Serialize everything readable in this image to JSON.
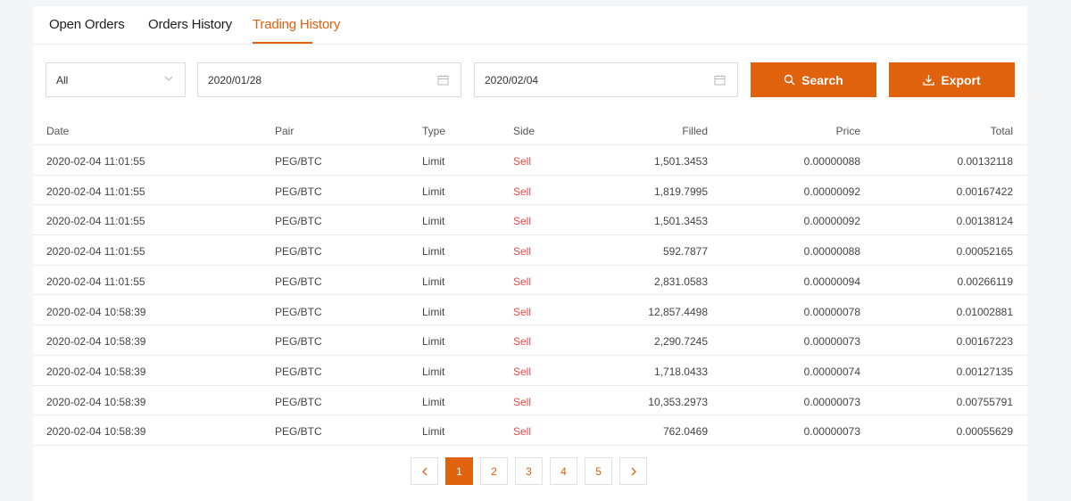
{
  "tabs": [
    {
      "label": "Open Orders"
    },
    {
      "label": "Orders History"
    },
    {
      "label": "Trading History"
    }
  ],
  "active_tab": 2,
  "filters": {
    "side_select": "All",
    "start_date": "2020/01/28",
    "end_date": "2020/02/04",
    "search_label": "Search",
    "export_label": "Export"
  },
  "table": {
    "headers": {
      "date": "Date",
      "pair": "Pair",
      "type": "Type",
      "side": "Side",
      "filled": "Filled",
      "price": "Price",
      "total": "Total"
    },
    "rows": [
      {
        "date": "2020-02-04 11:01:55",
        "pair": "PEG/BTC",
        "type": "Limit",
        "side": "Sell",
        "filled": "1,501.3453",
        "price": "0.00000088",
        "total": "0.00132118"
      },
      {
        "date": "2020-02-04 11:01:55",
        "pair": "PEG/BTC",
        "type": "Limit",
        "side": "Sell",
        "filled": "1,819.7995",
        "price": "0.00000092",
        "total": "0.00167422"
      },
      {
        "date": "2020-02-04 11:01:55",
        "pair": "PEG/BTC",
        "type": "Limit",
        "side": "Sell",
        "filled": "1,501.3453",
        "price": "0.00000092",
        "total": "0.00138124"
      },
      {
        "date": "2020-02-04 11:01:55",
        "pair": "PEG/BTC",
        "type": "Limit",
        "side": "Sell",
        "filled": "592.7877",
        "price": "0.00000088",
        "total": "0.00052165"
      },
      {
        "date": "2020-02-04 11:01:55",
        "pair": "PEG/BTC",
        "type": "Limit",
        "side": "Sell",
        "filled": "2,831.0583",
        "price": "0.00000094",
        "total": "0.00266119"
      },
      {
        "date": "2020-02-04 10:58:39",
        "pair": "PEG/BTC",
        "type": "Limit",
        "side": "Sell",
        "filled": "12,857.4498",
        "price": "0.00000078",
        "total": "0.01002881"
      },
      {
        "date": "2020-02-04 10:58:39",
        "pair": "PEG/BTC",
        "type": "Limit",
        "side": "Sell",
        "filled": "2,290.7245",
        "price": "0.00000073",
        "total": "0.00167223"
      },
      {
        "date": "2020-02-04 10:58:39",
        "pair": "PEG/BTC",
        "type": "Limit",
        "side": "Sell",
        "filled": "1,718.0433",
        "price": "0.00000074",
        "total": "0.00127135"
      },
      {
        "date": "2020-02-04 10:58:39",
        "pair": "PEG/BTC",
        "type": "Limit",
        "side": "Sell",
        "filled": "10,353.2973",
        "price": "0.00000073",
        "total": "0.00755791"
      },
      {
        "date": "2020-02-04 10:58:39",
        "pair": "PEG/BTC",
        "type": "Limit",
        "side": "Sell",
        "filled": "762.0469",
        "price": "0.00000073",
        "total": "0.00055629"
      }
    ]
  },
  "pagination": {
    "pages": [
      "1",
      "2",
      "3",
      "4",
      "5"
    ],
    "current": "1",
    "prev_icon": "chevron-left-icon",
    "next_icon": "chevron-right-icon"
  },
  "icons": {
    "select": "chevron-down-icon",
    "date": "calendar-icon",
    "search": "search-icon",
    "export": "download-icon"
  },
  "colors": {
    "accent": "#e0620d",
    "sell": "#f04848"
  }
}
